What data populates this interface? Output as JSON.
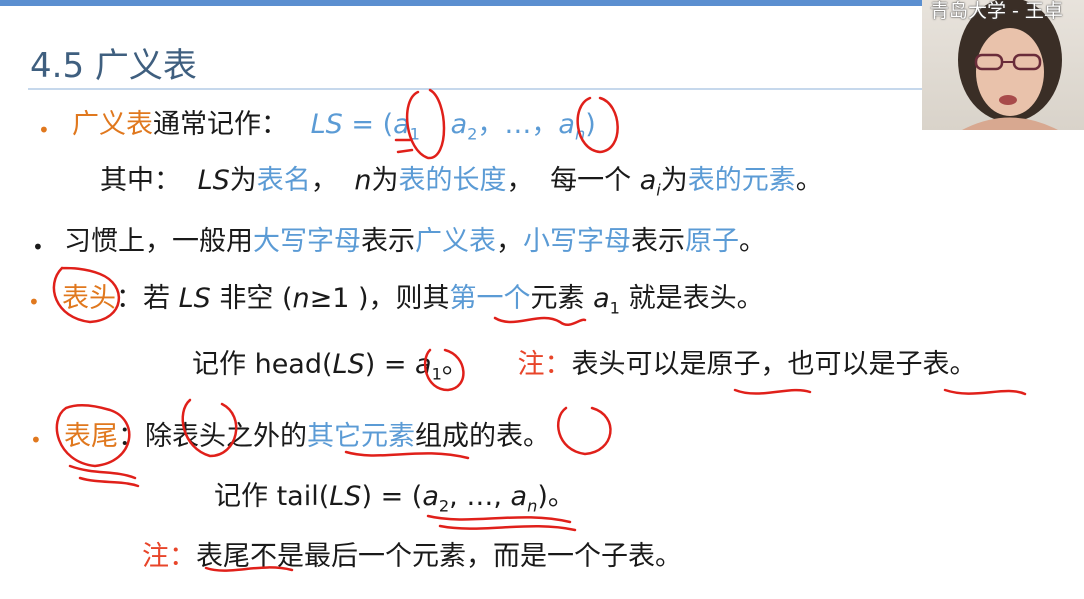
{
  "title": "4.5 广义表",
  "webcam_caption": "青岛大学 - 王卓",
  "bullets": {
    "b1": {
      "term": "广义表",
      "text": "通常记作：",
      "formula_ls": "LS",
      "formula_eq": " = (",
      "a": "a",
      "sub1": "1",
      "sep1": "，",
      "sub2": "2",
      "sep2": "，…，",
      "subn": "n",
      "close": ")"
    },
    "b1_sub": {
      "prefix": "其中：",
      "ls": "LS",
      "wei1": "为",
      "name": "表名",
      "comma1": "，",
      "n": "n",
      "wei2": "为",
      "length": "表的长度",
      "comma2": "，",
      "each": "每一个",
      "ai": "a",
      "ai_sub": "i",
      "wei3": "为",
      "elem": "表的元素",
      "end": "。"
    },
    "b2": {
      "p1": "习惯上，一般用",
      "upper": "大写字母",
      "p2": "表示",
      "list": "广义表",
      "p3": "，",
      "lower": "小写字母",
      "p4": "表示",
      "atom": "原子",
      "p5": "。"
    },
    "b3": {
      "term": "表头",
      "p1": "：若 ",
      "ls": "LS",
      "p2": " 非空 (",
      "n": "n",
      "p3": "≥1 )，则其",
      "first": "第一个",
      "p4": "元素 ",
      "a": "a",
      "a_sub": "1",
      "p5": " 就是表头。"
    },
    "b3_sub": {
      "p1": "记作 head(",
      "ls": "LS",
      "p2": ") = ",
      "a": "a",
      "a_sub": "1",
      "p3": "。",
      "note": "注：",
      "n1": "表头可以是原子，也可以是子表。"
    },
    "b4": {
      "term": "表尾",
      "p1": "：除表头之外的",
      "others": "其它元素",
      "p2": "组成的表。"
    },
    "b4_sub": {
      "p1": "记作  tail(",
      "ls": "LS",
      "p2": ") = (",
      "a": "a",
      "sub2": "2",
      "mid": ", …, ",
      "an": "a",
      "subn": "n",
      "p3": ")。"
    },
    "b4_note": {
      "note": "注：",
      "text": "表尾不是最后一个元素，而是一个子表。"
    }
  },
  "colors": {
    "accent_blue": "#5b9bd5",
    "term_orange": "#e0781e",
    "note_red": "#e8452a",
    "ink_red": "#e0201a",
    "title": "#3f5f7f"
  }
}
